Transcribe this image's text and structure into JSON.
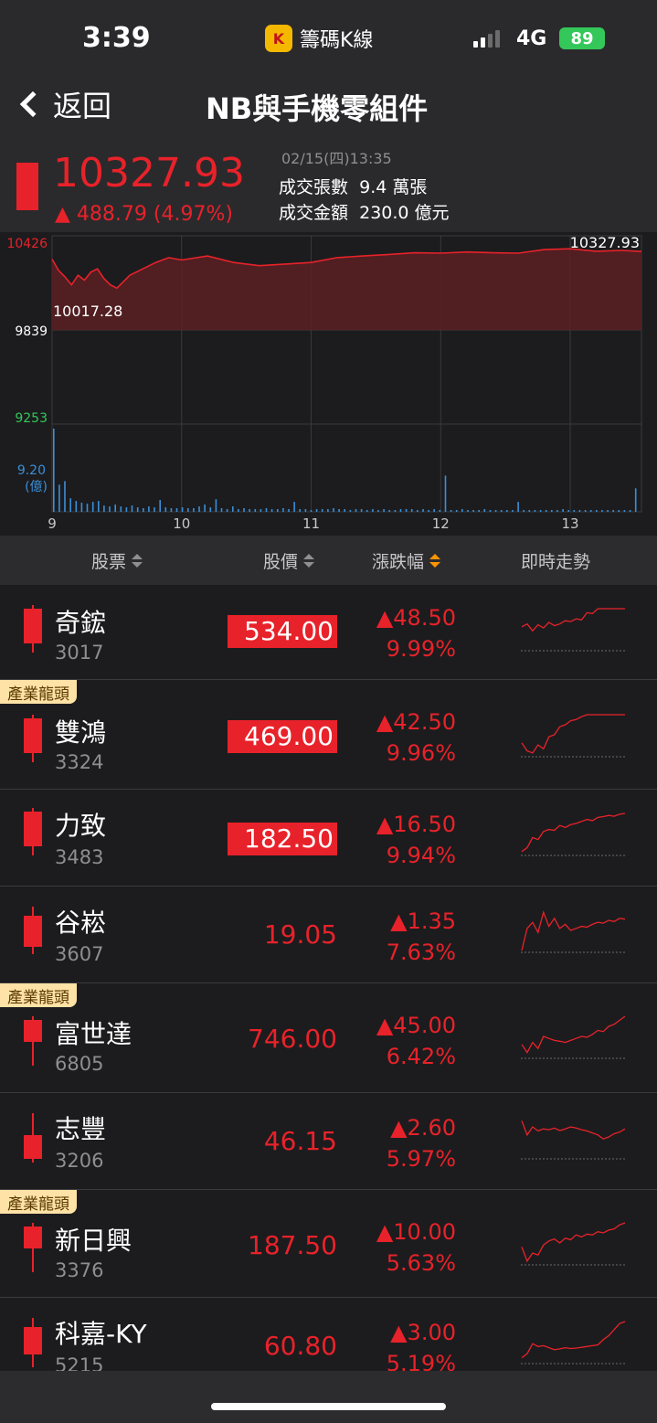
{
  "status": {
    "time": "3:39",
    "app_name": "籌碼K線",
    "app_logo_text": "K",
    "network": "4G",
    "battery": "89"
  },
  "nav": {
    "back_label": "返回",
    "title": "NB與手機零組件"
  },
  "index": {
    "value": "10327.93",
    "change": "▲ 488.79 (4.97%)",
    "time": "02/15(四)13:35",
    "volume_label": "成交張數",
    "volume": "9.4 萬張",
    "amount_label": "成交金額",
    "amount": "230.0 億元",
    "color_up": "#e8222a",
    "color_down": "#34c759"
  },
  "chart_data": {
    "type": "line",
    "title": "",
    "y_labels": {
      "high": "10426",
      "ref": "9839",
      "low": "9253"
    },
    "last_value_label": "10327.93",
    "min_value_label": "10017.28",
    "volume_label_value": "9.20",
    "volume_label_unit": "(億)",
    "x_ticks": [
      "9",
      "10",
      "11",
      "12",
      "13"
    ],
    "ylim": [
      9253,
      10426
    ],
    "x_range": [
      9,
      13.55
    ],
    "series": [
      {
        "x": [
          9.0,
          9.05,
          9.1,
          9.15,
          9.2,
          9.25,
          9.3,
          9.35,
          9.4,
          9.45,
          9.5,
          9.6,
          9.7,
          9.8,
          9.9,
          10.0,
          10.2,
          10.4,
          10.6,
          10.8,
          11.0,
          11.2,
          11.4,
          11.6,
          11.8,
          12.0,
          12.2,
          12.4,
          12.6,
          12.8,
          13.0,
          13.2,
          13.4,
          13.55
        ],
        "values": [
          10280,
          10210,
          10170,
          10120,
          10180,
          10150,
          10200,
          10220,
          10160,
          10120,
          10100,
          10180,
          10220,
          10260,
          10290,
          10275,
          10300,
          10260,
          10240,
          10250,
          10260,
          10290,
          10300,
          10310,
          10320,
          10318,
          10325,
          10320,
          10318,
          10340,
          10345,
          10330,
          10335,
          10328
        ]
      }
    ],
    "volume": [
      9.2,
      3.0,
      3.4,
      1.5,
      1.2,
      1.0,
      0.9,
      1.1,
      1.2,
      0.7,
      0.6,
      0.8,
      0.6,
      0.5,
      0.7,
      0.5,
      0.4,
      0.6,
      0.5,
      1.3,
      0.5,
      0.4,
      0.4,
      0.5,
      0.4,
      0.4,
      0.6,
      0.8,
      0.5,
      1.4,
      0.4,
      0.3,
      0.6,
      0.3,
      0.4,
      0.3,
      0.3,
      0.3,
      0.4,
      0.3,
      0.3,
      0.4,
      0.3,
      1.1,
      0.3,
      0.3,
      0.2,
      0.3,
      0.3,
      0.3,
      0.4,
      0.3,
      0.3,
      0.2,
      0.3,
      0.3,
      0.2,
      0.3,
      0.2,
      0.3,
      0.2,
      0.2,
      0.3,
      0.3,
      0.3,
      0.2,
      0.3,
      0.2,
      0.3,
      0.2,
      4.0,
      0.2,
      0.2,
      0.3,
      0.2,
      0.2,
      0.2,
      0.3,
      0.2,
      0.2,
      0.2,
      0.2,
      0.2,
      1.1,
      0.2,
      0.2,
      0.2,
      0.2,
      0.2,
      0.2,
      0.2,
      0.3,
      0.2,
      0.2,
      0.2,
      0.2,
      0.2,
      0.2,
      0.2,
      0.2,
      0.2,
      0.2,
      0.2,
      0.2,
      2.6
    ]
  },
  "table": {
    "headers": {
      "stock": "股票",
      "price": "股價",
      "change": "漲跌幅",
      "trend": "即時走勢"
    },
    "leader_badge": "產業龍頭",
    "rows": [
      {
        "name": "奇鋐",
        "code": "3017",
        "price": "534.00",
        "change": "▲48.50",
        "pct": "9.99%",
        "limit_up": true,
        "leader": false
      },
      {
        "name": "雙鴻",
        "code": "3324",
        "price": "469.00",
        "change": "▲42.50",
        "pct": "9.96%",
        "limit_up": true,
        "leader": true
      },
      {
        "name": "力致",
        "code": "3483",
        "price": "182.50",
        "change": "▲16.50",
        "pct": "9.94%",
        "limit_up": true,
        "leader": false
      },
      {
        "name": "谷崧",
        "code": "3607",
        "price": "19.05",
        "change": "▲1.35",
        "pct": "7.63%",
        "limit_up": false,
        "leader": false
      },
      {
        "name": "富世達",
        "code": "6805",
        "price": "746.00",
        "change": "▲45.00",
        "pct": "6.42%",
        "limit_up": false,
        "leader": true
      },
      {
        "name": "志豐",
        "code": "3206",
        "price": "46.15",
        "change": "▲2.60",
        "pct": "5.97%",
        "limit_up": false,
        "leader": false
      },
      {
        "name": "新日興",
        "code": "3376",
        "price": "187.50",
        "change": "▲10.00",
        "pct": "5.63%",
        "limit_up": false,
        "leader": true
      },
      {
        "name": "科嘉-KY",
        "code": "5215",
        "price": "60.80",
        "change": "▲3.00",
        "pct": "5.19%",
        "limit_up": false,
        "leader": false
      }
    ],
    "sparks": [
      {
        "values": [
          0.55,
          0.62,
          0.45,
          0.6,
          0.52,
          0.66,
          0.58,
          0.62,
          0.7,
          0.68,
          0.75,
          0.72,
          0.9,
          0.88,
          1,
          1,
          1,
          1,
          1,
          1
        ]
      },
      {
        "values": [
          0.3,
          0.1,
          0.05,
          0.25,
          0.15,
          0.45,
          0.5,
          0.7,
          0.75,
          0.85,
          0.88,
          0.95,
          1,
          1,
          1,
          1,
          1,
          1,
          1,
          1
        ]
      },
      {
        "values": [
          0.05,
          0.15,
          0.4,
          0.35,
          0.55,
          0.6,
          0.58,
          0.7,
          0.65,
          0.72,
          0.75,
          0.8,
          0.85,
          0.82,
          0.9,
          0.92,
          0.95,
          0.93,
          0.98,
          1
        ]
      },
      {
        "values": [
          0.0,
          0.55,
          0.7,
          0.45,
          0.95,
          0.6,
          0.8,
          0.55,
          0.65,
          0.5,
          0.55,
          0.6,
          0.58,
          0.65,
          0.7,
          0.68,
          0.75,
          0.72,
          0.8,
          0.78
        ]
      },
      {
        "values": [
          0.3,
          0.1,
          0.35,
          0.2,
          0.5,
          0.45,
          0.4,
          0.38,
          0.35,
          0.4,
          0.45,
          0.5,
          0.48,
          0.55,
          0.65,
          0.62,
          0.75,
          0.8,
          0.9,
          1
        ]
      },
      {
        "values": [
          0.9,
          0.55,
          0.75,
          0.65,
          0.7,
          0.68,
          0.72,
          0.66,
          0.7,
          0.75,
          0.72,
          0.68,
          0.65,
          0.6,
          0.55,
          0.45,
          0.5,
          0.58,
          0.62,
          0.7
        ]
      },
      {
        "values": [
          0.4,
          0.05,
          0.25,
          0.2,
          0.45,
          0.55,
          0.6,
          0.5,
          0.62,
          0.58,
          0.7,
          0.65,
          0.72,
          0.7,
          0.78,
          0.75,
          0.82,
          0.85,
          0.95,
          1
        ]
      },
      {
        "values": [
          0.1,
          0.2,
          0.45,
          0.38,
          0.4,
          0.35,
          0.3,
          0.32,
          0.35,
          0.33,
          0.34,
          0.36,
          0.38,
          0.4,
          0.42,
          0.55,
          0.65,
          0.8,
          0.95,
          1
        ]
      }
    ]
  }
}
